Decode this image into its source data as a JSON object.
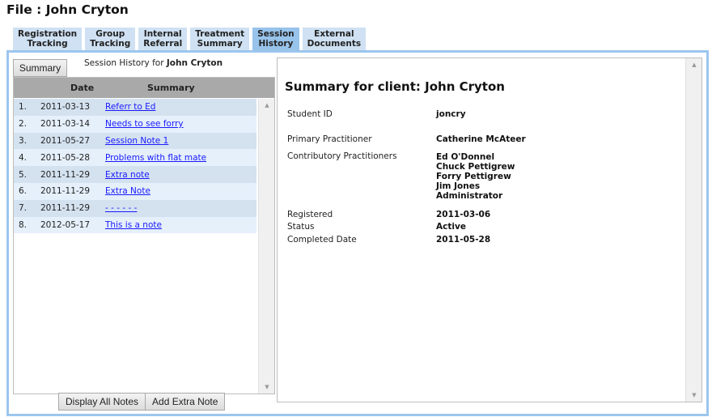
{
  "page": {
    "title": "File : John Cryton"
  },
  "tabs": [
    {
      "line1": "Registration",
      "line2": "Tracking",
      "active": false
    },
    {
      "line1": "Group",
      "line2": "Tracking",
      "active": false
    },
    {
      "line1": "Internal",
      "line2": "Referral",
      "active": false
    },
    {
      "line1": "Treatment",
      "line2": "Summary",
      "active": false
    },
    {
      "line1": "Session",
      "line2": "History",
      "active": true
    },
    {
      "line1": "External",
      "line2": "Documents",
      "active": false
    }
  ],
  "history": {
    "summary_button": "Summary",
    "title_prefix": "Session History for ",
    "client_name": "John Cryton",
    "columns": {
      "date": "Date",
      "summary": "Summary"
    },
    "rows": [
      {
        "num": "1.",
        "date": "2011-03-13",
        "summary": "Referr to Ed"
      },
      {
        "num": "2.",
        "date": "2011-03-14",
        "summary": "Needs to see forry"
      },
      {
        "num": "3.",
        "date": "2011-05-27",
        "summary": "Session Note 1"
      },
      {
        "num": "4.",
        "date": "2011-05-28",
        "summary": "Problems with flat mate"
      },
      {
        "num": "5.",
        "date": "2011-11-29",
        "summary": "Extra note"
      },
      {
        "num": "6.",
        "date": "2011-11-29",
        "summary": "Extra Note"
      },
      {
        "num": "7.",
        "date": "2011-11-29",
        "summary": "- - - - - -"
      },
      {
        "num": "8.",
        "date": "2012-05-17",
        "summary": "This is a note"
      }
    ],
    "buttons": {
      "display_all": "Display All Notes",
      "add_extra": "Add Extra Note"
    }
  },
  "detail": {
    "title": "Summary for client: John Cryton",
    "student_id_label": "Student ID",
    "student_id": "joncry",
    "primary_label": "Primary Practitioner",
    "primary": "Catherine McAteer",
    "contributory_label": "Contributory Practitioners",
    "contributory": [
      "Ed O'Donnel",
      "Chuck Pettigrew",
      "Forry Pettigrew",
      "Jim Jones",
      "Administrator"
    ],
    "registered_label": "Registered",
    "registered": "2011-03-06",
    "status_label": "Status",
    "status": "Active",
    "completed_label": "Completed Date",
    "completed": "2011-05-28"
  },
  "icons": {
    "scroll_up": "▲",
    "scroll_down": "▼"
  },
  "colors": {
    "tab": "#cfe1f3",
    "tab_active": "#98c3ea",
    "frame_border": "#9cc6ee",
    "link": "#1a1aff",
    "row_odd": "#d4e2f0",
    "row_even": "#e5f0fb",
    "header": "#a9a9a9"
  }
}
